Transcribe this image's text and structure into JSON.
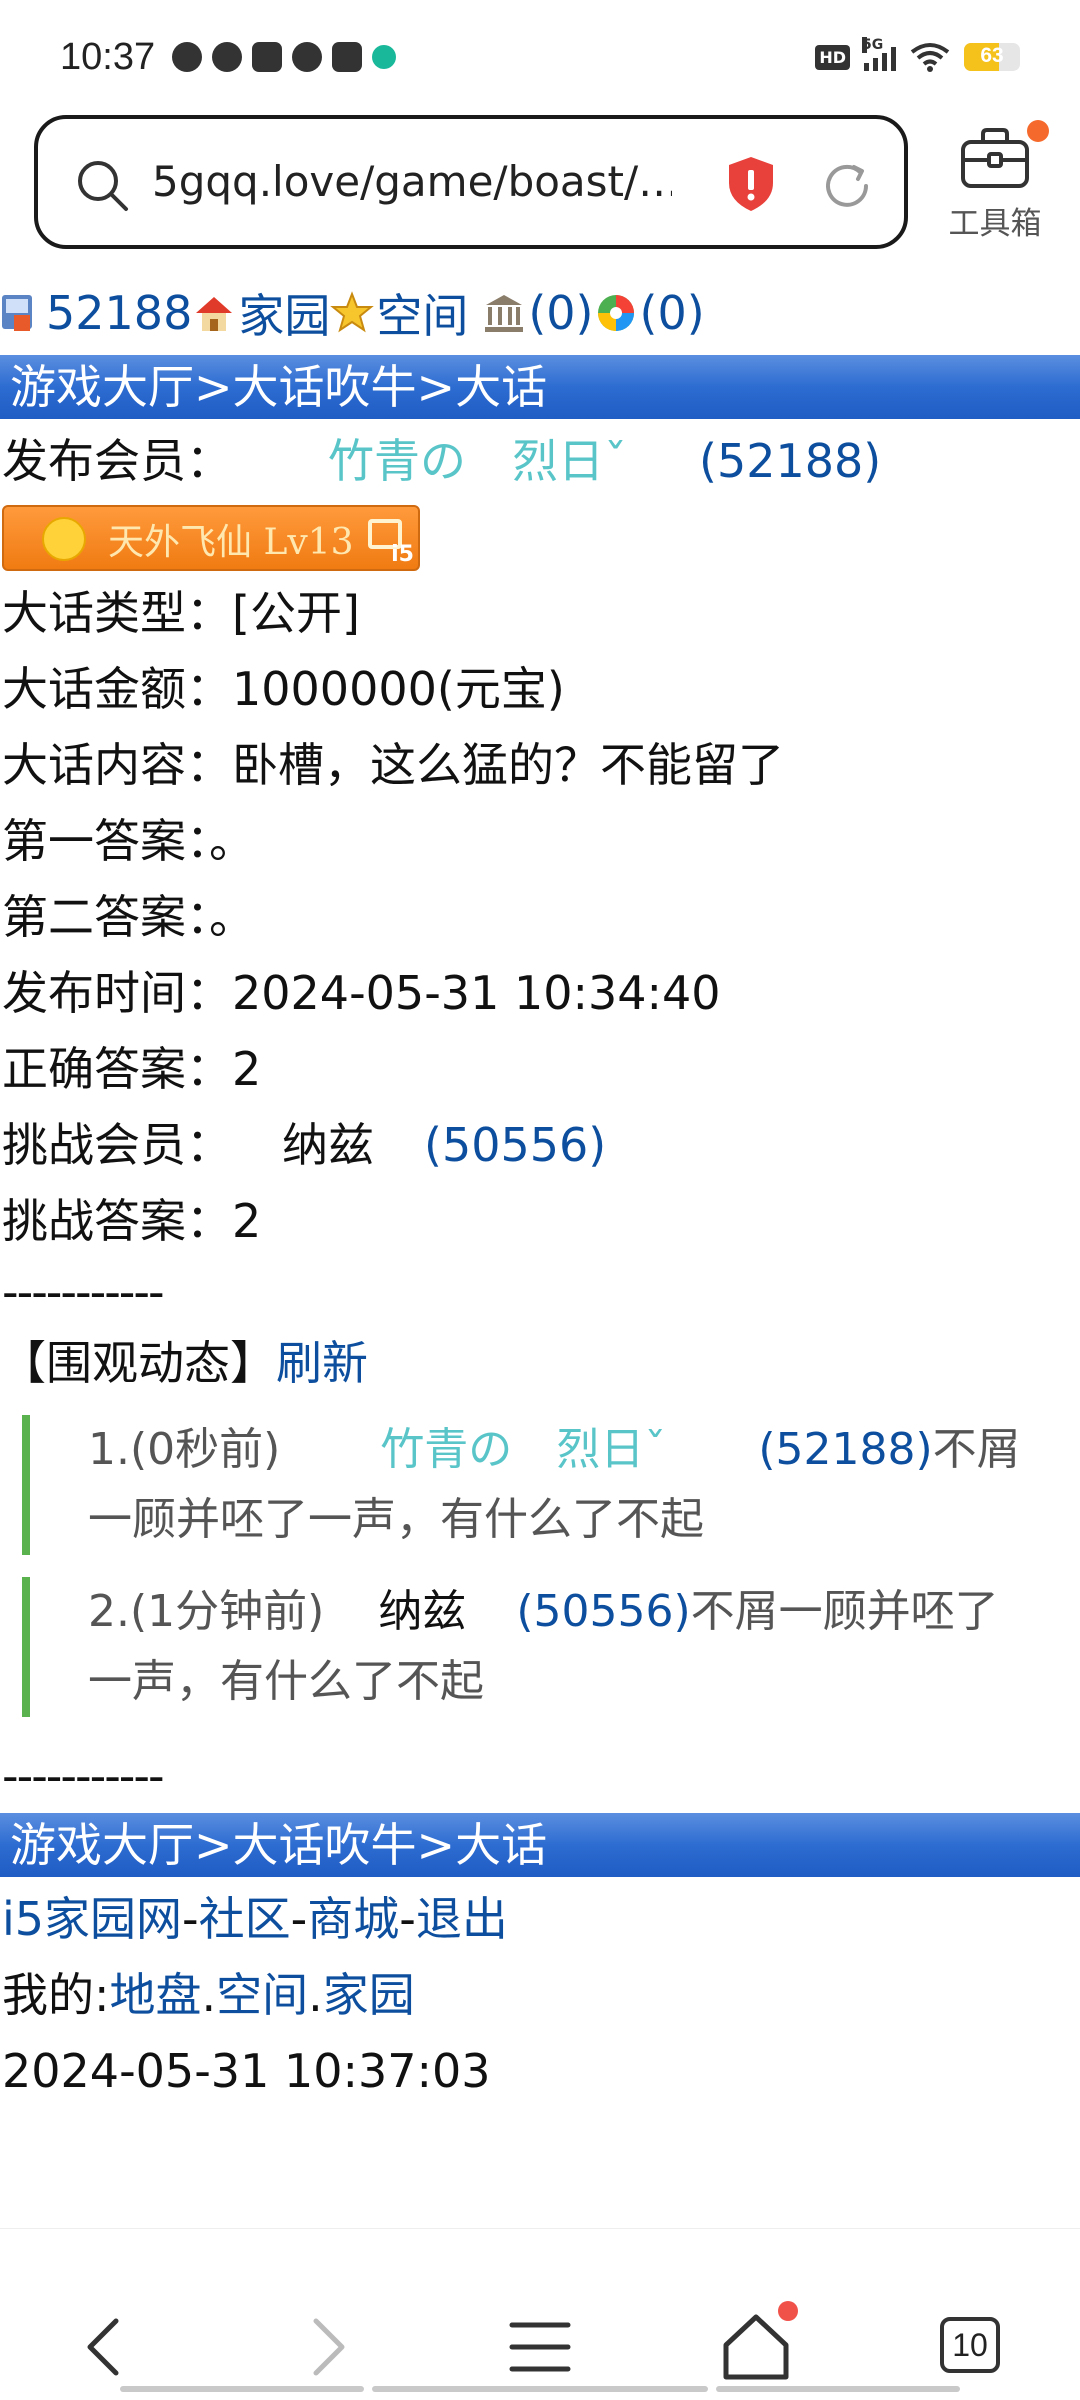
{
  "status_bar": {
    "time": "10:37",
    "battery": "63",
    "network": "5G"
  },
  "address_bar": {
    "url": "5gqq.love/game/boast/…"
  },
  "toolbox": {
    "label": "工具箱"
  },
  "top_links": {
    "user_id": "52188",
    "home": "家园",
    "space": "空间",
    "bank": "(0)",
    "wheel": "(0)"
  },
  "breadcrumb": "游戏大厅>大话吹牛>大话",
  "details": {
    "publisher_label": "发布会员：",
    "publisher_name": "竹青の　烈日ˇ",
    "publisher_id": "(52188)",
    "badge_text": "天外飞仙  Lv13",
    "badge_logo": "i5",
    "type_label": "大话类型：",
    "type_value": "[公开]",
    "amount_label": "大话金额：",
    "amount_value": "1000000(元宝)",
    "content_label": "大话内容：",
    "content_value": "卧槽，这么猛的？不能留了",
    "answer1_label": "第一答案：",
    "answer1_value": "。",
    "answer2_label": "第二答案：",
    "answer2_value": "。",
    "time_label": "发布时间：",
    "time_value": "2024-05-31 10:34:40",
    "correct_label": "正确答案：",
    "correct_value": "2",
    "challenger_label": "挑战会员：",
    "challenger_name": "纳兹",
    "challenger_id": "(50556)",
    "challenge_answer_label": "挑战答案：",
    "challenge_answer_value": "2"
  },
  "divider": "-----------",
  "watch": {
    "title": "【围观动态】",
    "refresh": "刷新",
    "items": [
      {
        "prefix": "1.(0秒前)",
        "name": "竹青の　烈日ˇ",
        "id": "(52188)",
        "text": "不屑一顾并呸了一声，有什么了不起"
      },
      {
        "prefix": "2.(1分钟前)",
        "name": "纳兹",
        "id": "(50556)",
        "text": "不屑一顾并呸了一声，有什么了不起"
      }
    ]
  },
  "footer": {
    "links": [
      "i5家园网",
      "社区",
      "商城",
      "退出"
    ],
    "sep": "-",
    "mine_label": "我的:",
    "mine_links": [
      "地盘",
      "空间",
      "家园"
    ],
    "dot": ".",
    "timestamp": "2024-05-31 10:37:03"
  },
  "bottom_nav": {
    "tab_count": "10"
  }
}
